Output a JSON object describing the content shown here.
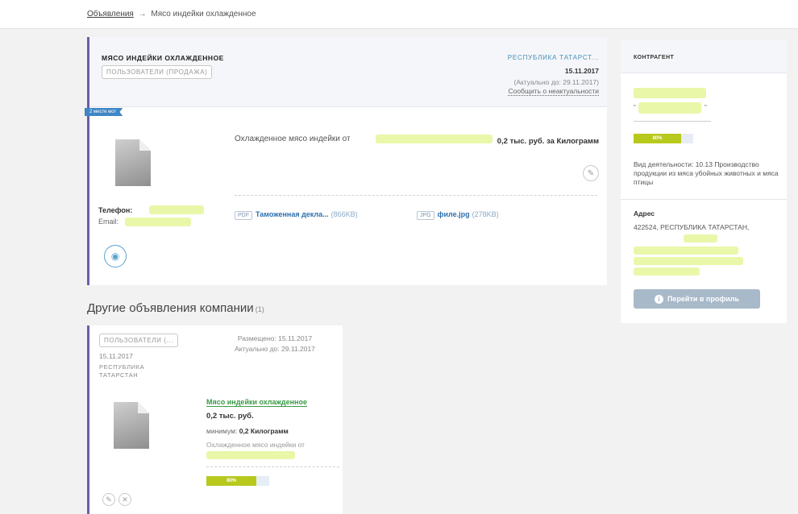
{
  "breadcrumb": {
    "root": "Объявления",
    "arrow": "→",
    "current": "Мясо индейки охлажденное"
  },
  "listing": {
    "title": "МЯСО ИНДЕЙКИ ОХЛАЖДЕННОЕ",
    "tag": "ПОЛЬЗОВАТЕЛИ (ПРОДАЖА)",
    "region": "РЕСПУБЛИКА ТАТАРСТ...",
    "date": "15.11.2017",
    "actual_until": "(Актуально до: 29.11.2017)",
    "report_link": "Сообщить о неактуальности",
    "ribbon": "2 месте мот",
    "description": "Охлажденное мясо индейки от",
    "price": "0,2 тыс. руб. за Килограмм",
    "phone_label": "Телефон:",
    "email_label": "Email:",
    "files": [
      {
        "ext": "PDF",
        "name": "Таможенная декла...",
        "size": "(866KB)"
      },
      {
        "ext": "JPG",
        "name": "филе.jpg",
        "size": "(278KB)"
      }
    ]
  },
  "counterparty": {
    "title": "КОНТРАГЕНТ",
    "quote_open": "\"",
    "quote_close": "\"",
    "rating_percent": 80,
    "rating_label": "80%",
    "activity": "Вид деятельности: 10.13 Производство продукции из мяса убойных животных и мяса птицы",
    "address_label": "Адрес",
    "address": "422524, РЕСПУБЛИКА ТАТАРСТАН,",
    "profile_button": "Перейти в профиль"
  },
  "other": {
    "heading": "Другие объявления компании",
    "count": "(1)",
    "items": [
      {
        "tag": "ПОЛЬЗОВАТЕЛИ (...",
        "date": "15.11.2017",
        "region": "РЕСПУБЛИКА ТАТАРСТАН",
        "placed": "Размещено: 15.11.2017",
        "actual": "Актуально до: 29.11.2017",
        "title": "Мясо индейки охлажденное",
        "price": "0,2 тыс. руб.",
        "min_label": "минимум:",
        "min_value": "0,2 Килограмм",
        "description": "Охлажденное мясо индейки от",
        "rating_percent": 80,
        "rating_label": "80%"
      }
    ]
  },
  "colors": {
    "accent": "#6a5fa8",
    "link": "#2e6fae",
    "progress": "#b7c91d",
    "redaction": "#e8f7a8",
    "green_title": "#3a9a46"
  }
}
